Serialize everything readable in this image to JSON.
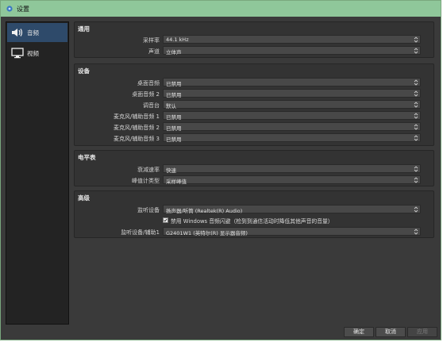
{
  "window": {
    "title": "设置"
  },
  "sidebar": {
    "items": [
      {
        "label": "音频"
      },
      {
        "label": "视频"
      }
    ]
  },
  "groups": {
    "general": {
      "title": "通用",
      "rows": [
        {
          "label": "采样率",
          "value": "44.1 kHz"
        },
        {
          "label": "声道",
          "value": "立体声"
        }
      ]
    },
    "devices": {
      "title": "设备",
      "rows": [
        {
          "label": "桌面音频",
          "value": "已禁用"
        },
        {
          "label": "桌面音频 2",
          "value": "已禁用"
        },
        {
          "label": "调音台",
          "value": "默认"
        },
        {
          "label": "麦克风/辅助音频 1",
          "value": "已禁用"
        },
        {
          "label": "麦克风/辅助音频 2",
          "value": "已禁用"
        },
        {
          "label": "麦克风/辅助音频 3",
          "value": "已禁用"
        }
      ]
    },
    "meters": {
      "title": "电平表",
      "rows": [
        {
          "label": "衰减速率",
          "value": "快速"
        },
        {
          "label": "峰值计类型",
          "value": "采样峰值"
        }
      ]
    },
    "advanced": {
      "title": "高级",
      "monitor_label": "监听设备",
      "monitor_value": "扬声器/听筒 (Realtek(R) Audio)",
      "checkbox_label": "禁用 Windows 音频闪避（检到到通信活动时降低其他声音的音量）",
      "checkbox_checked": true,
      "monitor2_label": "监听设备/辅助1",
      "monitor2_value": "G2401W1 (英特尔(R) 显示器音频)"
    }
  },
  "buttons": {
    "ok": "确定",
    "cancel": "取消",
    "apply": "应用"
  }
}
